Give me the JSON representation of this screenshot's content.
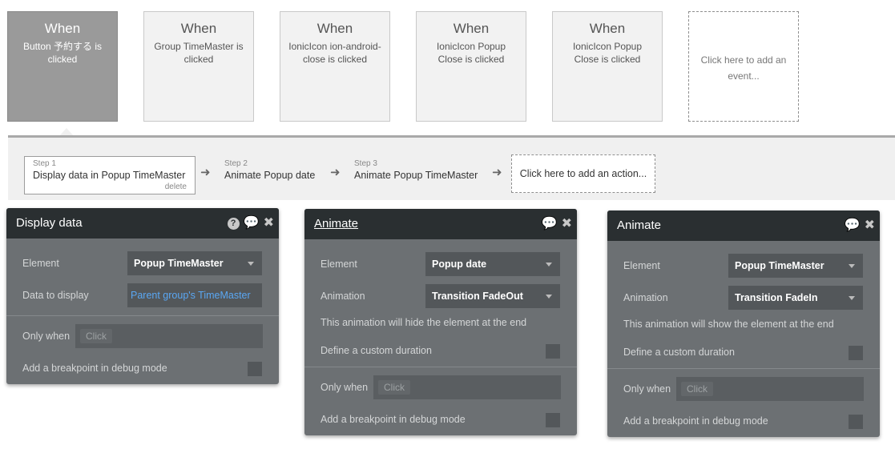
{
  "events": [
    {
      "when": "When",
      "desc": "Button 予約する is clicked",
      "selected": true
    },
    {
      "when": "When",
      "desc": "Group TimeMaster is clicked"
    },
    {
      "when": "When",
      "desc": "IonicIcon ion-android-close is clicked"
    },
    {
      "when": "When",
      "desc": "IonicIcon Popup Close is clicked"
    },
    {
      "when": "When",
      "desc": "IonicIcon Popup Close is clicked"
    }
  ],
  "add_event_label": "Click here to add an event...",
  "steps": [
    {
      "num": "Step 1",
      "name": "Display data in Popup TimeMaster",
      "delete": "delete"
    },
    {
      "num": "Step 2",
      "name": "Animate Popup date"
    },
    {
      "num": "Step 3",
      "name": "Animate Popup TimeMaster"
    }
  ],
  "add_action_label": "Click here to add an action...",
  "panels": {
    "display": {
      "title": "Display data",
      "element_label": "Element",
      "element_value": "Popup TimeMaster",
      "data_label": "Data to display",
      "data_value": "Parent group's TimeMaster",
      "only_when_label": "Only when",
      "click_placeholder": "Click",
      "breakpoint_label": "Add a breakpoint in debug mode"
    },
    "animate1": {
      "title": "Animate",
      "element_label": "Element",
      "element_value": "Popup date",
      "animation_label": "Animation",
      "animation_value": "Transition FadeOut",
      "info": "This animation will hide the element at the end",
      "custom_duration_label": "Define a custom duration",
      "only_when_label": "Only when",
      "click_placeholder": "Click",
      "breakpoint_label": "Add a breakpoint in debug mode"
    },
    "animate2": {
      "title": "Animate",
      "element_label": "Element",
      "element_value": "Popup TimeMaster",
      "animation_label": "Animation",
      "animation_value": "Transition FadeIn",
      "info": "This animation will show the element at the end",
      "custom_duration_label": "Define a custom duration",
      "only_when_label": "Only when",
      "click_placeholder": "Click",
      "breakpoint_label": "Add a breakpoint in debug mode"
    }
  },
  "icons": {
    "help": "?",
    "comment": "💬",
    "close": "✖",
    "arrow": "➜"
  }
}
